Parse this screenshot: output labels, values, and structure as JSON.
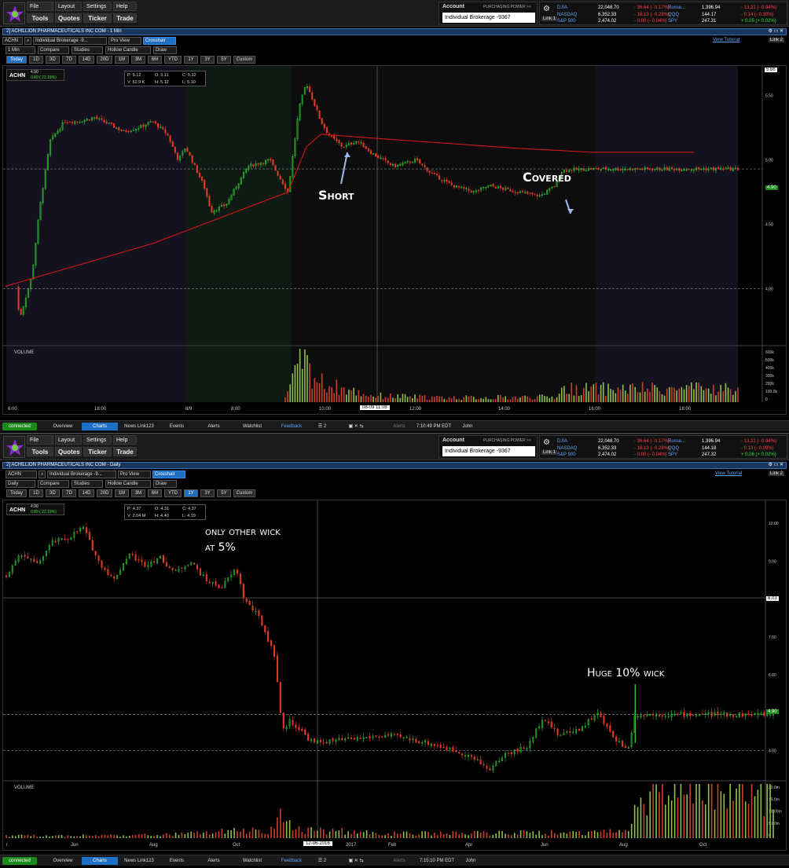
{
  "app": {
    "menu_row1": [
      "File",
      "Layout",
      "Settings",
      "Help"
    ],
    "menu_row2": [
      "Tools",
      "Quotes",
      "Ticker",
      "Trade"
    ],
    "account_label": "Account",
    "buying_power": "PURCHASING POWER >>",
    "account_value": "Individual Brokerage -9367",
    "link_label": "Link 1",
    "link2": "Link 2",
    "view_tutorial": "View Tutorial",
    "ticker_input": "ACHN",
    "account_short": "Individual Brokerage -9...",
    "view": "Pro View",
    "crosshair": "Crosshair",
    "compare": "Compare",
    "studies": "Studies",
    "candle": "Hollow Candle",
    "draw": "Draw",
    "ranges": [
      "Today",
      "1D",
      "3D",
      "7D",
      "14D",
      "20D",
      "1M",
      "3M",
      "6M",
      "YTD",
      "1Y",
      "3Y",
      "5Y",
      "Custom"
    ],
    "volume_label": "VOLUME",
    "status_tabs": [
      "connected",
      "Overview",
      "Charts",
      "News Link123",
      "Events",
      "Alerts",
      "Watchlist",
      "Feedback"
    ],
    "alerts_small": "Alerts",
    "user": "John",
    "colors": {
      "up": "#2fbf2f",
      "down": "#e03a2a",
      "accent": "#1f6fc4",
      "vwap": "#d01818"
    }
  },
  "panel1": {
    "window_title": "2] ACHILLION PHARMACEUTICALS INC COM - 1 Min",
    "interval": "1 Min",
    "selected_range": "Today",
    "indices": [
      {
        "name": "DJIA",
        "value": "22,048.70",
        "change": "- 36.64 (- 0.17%)",
        "name2": "Russe...",
        "value2": "1,396.94",
        "change2": "- 13.21 (- 0.94%)"
      },
      {
        "name": "NASDAQ",
        "value": "6,352.33",
        "change": "- 18.13 (- 0.28%)",
        "name2": "QQQ",
        "value2": "144.17",
        "change2": "- 0.14 (- 0.10%)"
      },
      {
        "name": "S&P 500",
        "value": "2,474.02",
        "change": "- 0.90 (- 0.04%)",
        "name2": "SPY",
        "value2": "247.31",
        "change2": "+ 0.05 (+ 0.02%)"
      }
    ],
    "ticker": {
      "symbol": "ACHN",
      "price": "4.90",
      "change": "0.89 ( 22.19%)"
    },
    "ohlc": {
      "p": "P: 5.12",
      "o": "O: 5.11",
      "c": "C: 5.12",
      "v": "V: 52.9 K",
      "h": "H: 5.12",
      "l": "L: 5.10"
    },
    "annotations": [
      "Short",
      "Covered"
    ],
    "crosshair_label": "08-09 11:08",
    "status_time": "7:10:49 PM EDT",
    "last_price_tag": "4.90",
    "top_tag": "5.66"
  },
  "panel2": {
    "window_title": "2] ACHILLION PHARMACEUTICALS INC COM - Daily",
    "interval": "Daily",
    "selected_range": "1Y",
    "indices": [
      {
        "name": "DJIA",
        "value": "22,048.70",
        "change": "- 36.64 (- 0.17%)",
        "name2": "Russe...",
        "value2": "1,396.94",
        "change2": "- 13.21 (- 0.94%)"
      },
      {
        "name": "NASDAQ",
        "value": "6,352.33",
        "change": "- 18.13 (- 0.28%)",
        "name2": "QQQ",
        "value2": "144.18",
        "change2": "- 0.13 (- 0.09%)"
      },
      {
        "name": "S&P 500",
        "value": "2,474.02",
        "change": "- 0.90 (- 0.04%)",
        "name2": "SPY",
        "value2": "247.32",
        "change2": "+ 0.06 (+ 0.02%)"
      }
    ],
    "ticker": {
      "symbol": "ACHN",
      "price": "4.90",
      "change": "0.89 ( 22.19%)"
    },
    "ohlc": {
      "p": "P: 4.37",
      "o": "O: 4.31",
      "c": "C: 4.37",
      "v": "V: 2.04 M",
      "h": "H: 4.40",
      "l": "L: 4.19"
    },
    "annotations": [
      "only other wick",
      "at 5%",
      "Huge 10% wick"
    ],
    "crosshair_label": "12-06-2016",
    "status_time": "7:15:10 PM EDT",
    "last_price_tag": "4.90",
    "crosshair_tag": "8.03"
  },
  "chart_data": [
    {
      "type": "candlestick",
      "title": "ACHILLION PHARMACEUTICALS INC COM - 1 Min",
      "x_ticks": [
        "6:00",
        "18:00",
        "8/9",
        "8:00",
        "10:00",
        "12:00",
        "14:00",
        "16:00",
        "18:00"
      ],
      "y_ticks": [
        4.0,
        4.5,
        5.0,
        5.5
      ],
      "ylim": [
        3.55,
        5.7
      ],
      "volume_ticks": [
        "600k",
        "500k",
        "400k",
        "300k",
        "200k",
        "100.0k",
        "0"
      ],
      "price_path": [
        [
          0,
          4.02
        ],
        [
          0.02,
          3.8
        ],
        [
          0.035,
          4.1
        ],
        [
          0.045,
          4.6
        ],
        [
          0.06,
          5.15
        ],
        [
          0.08,
          5.3
        ],
        [
          0.1,
          5.3
        ],
        [
          0.12,
          5.33
        ],
        [
          0.14,
          5.28
        ],
        [
          0.16,
          5.22
        ],
        [
          0.18,
          5.25
        ],
        [
          0.2,
          5.3
        ],
        [
          0.22,
          5.2
        ],
        [
          0.235,
          5.0
        ],
        [
          0.245,
          5.1
        ],
        [
          0.27,
          4.8
        ],
        [
          0.28,
          4.6
        ],
        [
          0.3,
          4.65
        ],
        [
          0.33,
          4.95
        ],
        [
          0.36,
          5.0
        ],
        [
          0.385,
          4.75
        ],
        [
          0.4,
          5.4
        ],
        [
          0.41,
          5.6
        ],
        [
          0.43,
          5.3
        ],
        [
          0.44,
          5.2
        ],
        [
          0.46,
          5.1
        ],
        [
          0.48,
          5.15
        ],
        [
          0.5,
          5.05
        ],
        [
          0.53,
          4.95
        ],
        [
          0.56,
          5.0
        ],
        [
          0.58,
          4.9
        ],
        [
          0.61,
          4.8
        ],
        [
          0.64,
          4.75
        ],
        [
          0.66,
          4.8
        ],
        [
          0.7,
          4.75
        ],
        [
          0.73,
          4.72
        ],
        [
          0.75,
          4.8
        ],
        [
          0.76,
          4.92
        ],
        [
          0.8,
          4.93
        ],
        [
          0.94,
          4.93
        ]
      ],
      "vwap_path": [
        [
          0,
          4.02
        ],
        [
          0.2,
          4.35
        ],
        [
          0.385,
          4.75
        ],
        [
          0.41,
          5.1
        ],
        [
          0.43,
          5.2
        ],
        [
          0.5,
          5.17
        ],
        [
          0.7,
          5.09
        ],
        [
          0.8,
          5.06
        ],
        [
          0.94,
          5.06
        ]
      ],
      "volume_path": [
        [
          0.385,
          0.25
        ],
        [
          0.395,
          0.6
        ],
        [
          0.405,
          1.0
        ],
        [
          0.415,
          0.7
        ],
        [
          0.43,
          0.45
        ],
        [
          0.46,
          0.3
        ],
        [
          0.5,
          0.15
        ],
        [
          0.6,
          0.1
        ],
        [
          0.75,
          0.12
        ],
        [
          0.76,
          0.3
        ]
      ],
      "annotations": [
        {
          "text": "Short",
          "x": 0.44,
          "y": 5.18
        },
        {
          "text": "Covered",
          "x": 0.73,
          "y": 4.72
        }
      ]
    },
    {
      "type": "candlestick",
      "title": "ACHILLION PHARMACEUTICALS INC COM - Daily",
      "x_ticks": [
        "r",
        "Jun",
        "Aug",
        "Oct",
        "2017",
        "Feb",
        "Apr",
        "Jun",
        "Aug",
        "Oct"
      ],
      "y_ticks": [
        4.0,
        5.0,
        6.0,
        7.0,
        8.0,
        9.0,
        10.0
      ],
      "ylim": [
        3.2,
        10.5
      ],
      "volume_ticks": [
        "20.0m",
        "15.0m",
        "10.00m",
        "5.00m",
        "0"
      ],
      "price_path": [
        [
          0,
          8.6
        ],
        [
          0.02,
          9.2
        ],
        [
          0.04,
          8.9
        ],
        [
          0.06,
          9.5
        ],
        [
          0.08,
          9.6
        ],
        [
          0.1,
          9.9
        ],
        [
          0.12,
          9.0
        ],
        [
          0.14,
          8.5
        ],
        [
          0.16,
          9.2
        ],
        [
          0.18,
          8.9
        ],
        [
          0.2,
          9.1
        ],
        [
          0.22,
          8.7
        ],
        [
          0.24,
          9.0
        ],
        [
          0.26,
          8.5
        ],
        [
          0.28,
          8.3
        ],
        [
          0.3,
          8.8
        ],
        [
          0.31,
          8.0
        ],
        [
          0.33,
          7.5
        ],
        [
          0.35,
          6.5
        ],
        [
          0.36,
          4.5
        ],
        [
          0.37,
          4.8
        ],
        [
          0.4,
          4.2
        ],
        [
          0.45,
          4.3
        ],
        [
          0.5,
          4.4
        ],
        [
          0.55,
          4.2
        ],
        [
          0.6,
          3.9
        ],
        [
          0.63,
          3.5
        ],
        [
          0.65,
          3.9
        ],
        [
          0.68,
          4.1
        ],
        [
          0.7,
          4.9
        ],
        [
          0.72,
          4.4
        ],
        [
          0.75,
          4.6
        ],
        [
          0.77,
          5.0
        ],
        [
          0.79,
          4.4
        ],
        [
          0.81,
          4.0
        ],
        [
          0.82,
          4.95
        ]
      ],
      "volume_path": [
        [
          0,
          0.05
        ],
        [
          0.2,
          0.07
        ],
        [
          0.35,
          0.2
        ],
        [
          0.36,
          0.55
        ],
        [
          0.38,
          0.2
        ],
        [
          0.5,
          0.1
        ],
        [
          0.7,
          0.12
        ],
        [
          0.81,
          0.15
        ],
        [
          0.82,
          1.0
        ]
      ],
      "annotations": [
        {
          "text": "only other wick at 5%",
          "x": 0.26,
          "y": 9.4
        },
        {
          "text": "Huge 10% wick",
          "x": 0.8,
          "y": 6.0
        }
      ]
    }
  ]
}
